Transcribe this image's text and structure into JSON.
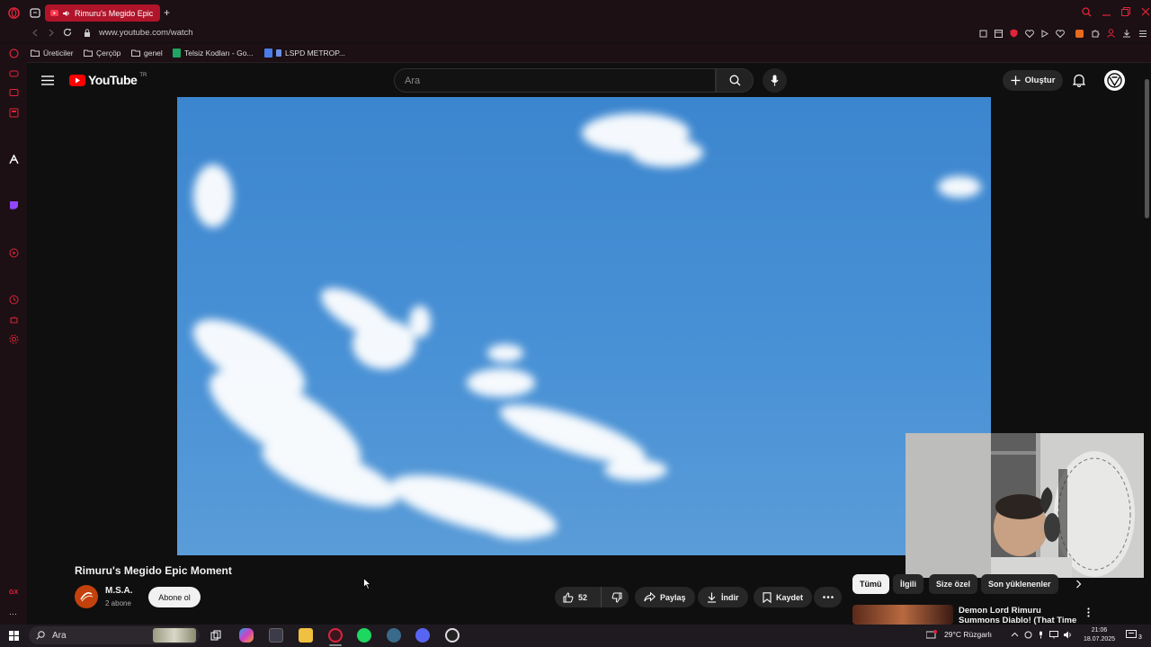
{
  "browser": {
    "tab_title": "Rimuru's Megido Epic",
    "url": "www.youtube.com/watch",
    "bookmarks": [
      "Üreticiler",
      "Çerçöp",
      "genel",
      "Telsiz Kodları - Go...",
      "LSPD METROP..."
    ]
  },
  "youtube": {
    "logo_text": "YouTube",
    "region": "TR",
    "search_placeholder": "Ara",
    "create_label": "Oluştur"
  },
  "video": {
    "title": "Rimuru's Megido Epic Moment",
    "channel": "M.S.A.",
    "subscribers": "2 abone",
    "subscribe_label": "Abone ol",
    "likes": "52",
    "share_label": "Paylaş",
    "download_label": "İndir",
    "save_label": "Kaydet"
  },
  "chips": [
    "Tümü",
    "İlgili",
    "Size özel",
    "Son yüklenenler"
  ],
  "recommendation": {
    "title": "Demon Lord Rimuru Summons Diablo! (That Time I Got"
  },
  "taskbar": {
    "search_label": "Ara",
    "weather": "29°C  Rüzgarlı",
    "time": "21:06",
    "date": "18.07.2025",
    "notification_count": "3"
  },
  "colors": {
    "youtube_red": "#ff0000",
    "tab_active": "#b0142a",
    "background": "#0f0f0f",
    "sky": "#4a92d6"
  }
}
